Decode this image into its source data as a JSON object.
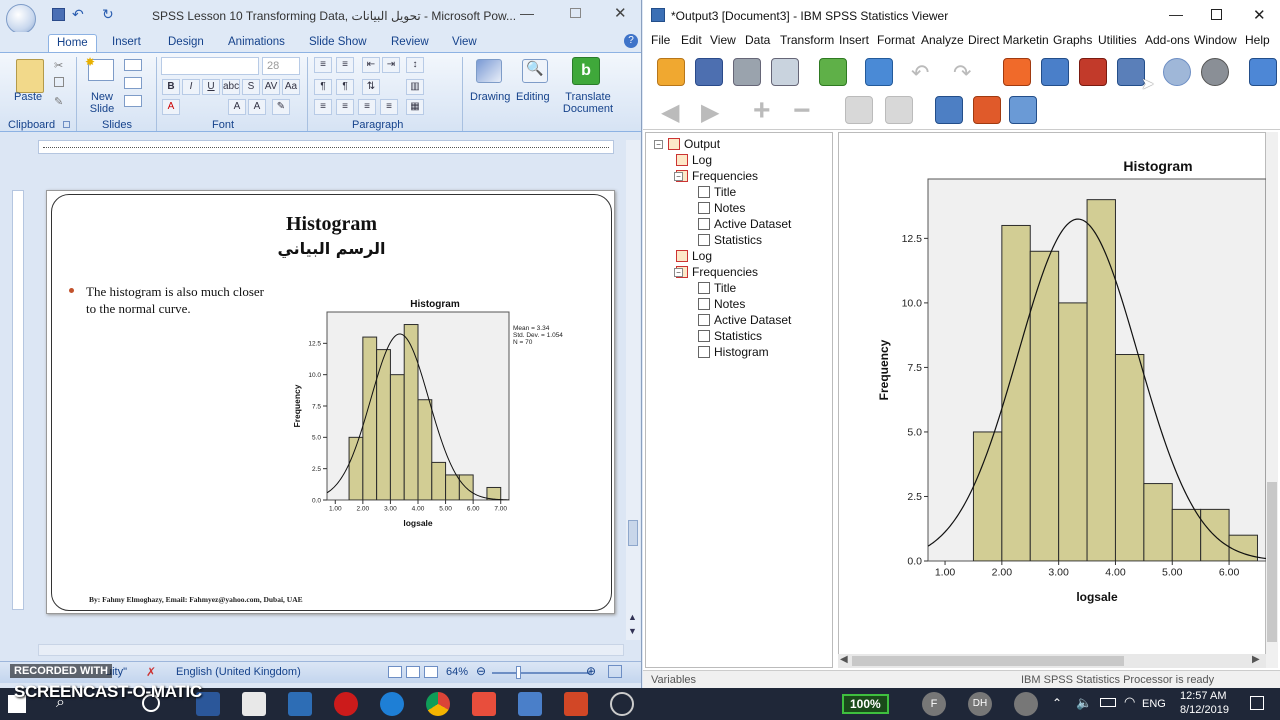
{
  "ppt": {
    "window_title": "SPSS Lesson 10 Transforming Data, تحويل البيانات - Microsoft Pow...",
    "tabs": [
      "Home",
      "Insert",
      "Design",
      "Animations",
      "Slide Show",
      "Review",
      "View"
    ],
    "ribbon": {
      "paste": "Paste",
      "new_slide": "New Slide",
      "font_size": "28",
      "drawing": "Drawing",
      "editing": "Editing",
      "translate": "Translate Document",
      "groups": [
        "Clipboard",
        "Slides",
        "Font",
        "Paragraph"
      ]
    },
    "slide": {
      "title": "Histogram",
      "subtitle": "الرسم البياني",
      "bullet": "The histogram is also much closer to the normal curve.",
      "footer": "By: Fahmy Elmoghazy, Email: Fahmyez@yahoo.com, Dubai, UAE"
    },
    "status": {
      "recorded": "RECORDED WITH",
      "theme": "uity\"",
      "language": "English (United Kingdom)",
      "zoom": "64%"
    }
  },
  "ppt_chart": {
    "chart_data": {
      "type": "bar",
      "title": "Histogram",
      "xlabel": "logsale",
      "ylabel": "Frequency",
      "bins": [
        [
          1.5,
          2.0
        ],
        [
          2.0,
          2.5
        ],
        [
          2.5,
          3.0
        ],
        [
          3.0,
          3.5
        ],
        [
          3.5,
          4.0
        ],
        [
          4.0,
          4.5
        ],
        [
          4.5,
          5.0
        ],
        [
          5.0,
          5.5
        ],
        [
          5.5,
          6.0
        ],
        [
          6.0,
          6.5
        ],
        [
          6.5,
          7.0
        ]
      ],
      "values": [
        5,
        13,
        12,
        10,
        14,
        8,
        3,
        2,
        2,
        0,
        1
      ],
      "xticks": [
        "1.00",
        "2.00",
        "3.00",
        "4.00",
        "5.00",
        "6.00",
        "7.00"
      ],
      "yticks": [
        "0.0",
        "2.5",
        "5.0",
        "7.5",
        "10.0",
        "12.5"
      ],
      "xlim": [
        0.7,
        7.3
      ],
      "ylim": [
        0,
        15
      ],
      "stats": [
        "Mean = 3.34",
        "Std. Dev. = 1.054",
        "N = 70"
      ],
      "normal_curve": {
        "mean": 3.34,
        "sd": 1.054,
        "n": 70,
        "binwidth": 0.5
      }
    }
  },
  "spss": {
    "window_title": "*Output3 [Document3] - IBM SPSS Statistics Viewer",
    "menu": [
      "File",
      "Edit",
      "View",
      "Data",
      "Transform",
      "Insert",
      "Format",
      "Analyze",
      "Direct Marketing",
      "Graphs",
      "Utilities",
      "Add-ons",
      "Window",
      "Help"
    ],
    "outline": [
      {
        "label": "Output",
        "level": 0
      },
      {
        "label": "Log",
        "level": 1
      },
      {
        "label": "Frequencies",
        "level": 1
      },
      {
        "label": "Title",
        "level": 2
      },
      {
        "label": "Notes",
        "level": 2
      },
      {
        "label": "Active Dataset",
        "level": 2
      },
      {
        "label": "Statistics",
        "level": 2
      },
      {
        "label": "Log",
        "level": 1
      },
      {
        "label": "Frequencies",
        "level": 1
      },
      {
        "label": "Title",
        "level": 2
      },
      {
        "label": "Notes",
        "level": 2
      },
      {
        "label": "Active Dataset",
        "level": 2
      },
      {
        "label": "Statistics",
        "level": 2
      },
      {
        "label": "Histogram",
        "level": 2
      }
    ],
    "status": {
      "left": "Variables",
      "right": "IBM SPSS Statistics Processor is ready"
    }
  },
  "spss_chart": {
    "chart_data": {
      "type": "bar",
      "title": "Histogram",
      "xlabel": "logsale",
      "ylabel": "Frequency",
      "bins": [
        [
          1.5,
          2.0
        ],
        [
          2.0,
          2.5
        ],
        [
          2.5,
          3.0
        ],
        [
          3.0,
          3.5
        ],
        [
          3.5,
          4.0
        ],
        [
          4.0,
          4.5
        ],
        [
          4.5,
          5.0
        ],
        [
          5.0,
          5.5
        ],
        [
          5.5,
          6.0
        ],
        [
          6.0,
          6.5
        ]
      ],
      "values": [
        5,
        13,
        12,
        10,
        14,
        8,
        3,
        2,
        2,
        1
      ],
      "xticks": [
        "1.00",
        "2.00",
        "3.00",
        "4.00",
        "5.00",
        "6.00"
      ],
      "yticks": [
        "0.0",
        "2.5",
        "5.0",
        "7.5",
        "10.0",
        "12.5"
      ],
      "xlim": [
        0.7,
        6.65
      ],
      "ylim": [
        0,
        14.8
      ],
      "normal_curve": {
        "mean": 3.34,
        "sd": 1.054,
        "n": 70,
        "binwidth": 0.5
      }
    }
  },
  "taskbar": {
    "watermark": "SCREENCAST-O-MATIC",
    "battery": "100%",
    "avatar1": "F",
    "avatar2": "DH",
    "lang": "ENG",
    "time": "12:57 AM",
    "date": "8/12/2019"
  },
  "colors": {
    "bar_fill": "#d2cd94",
    "bar_stroke": "#2b2b2b",
    "ribbon_blue": "#15428b",
    "taskbar": "#1f2738"
  }
}
